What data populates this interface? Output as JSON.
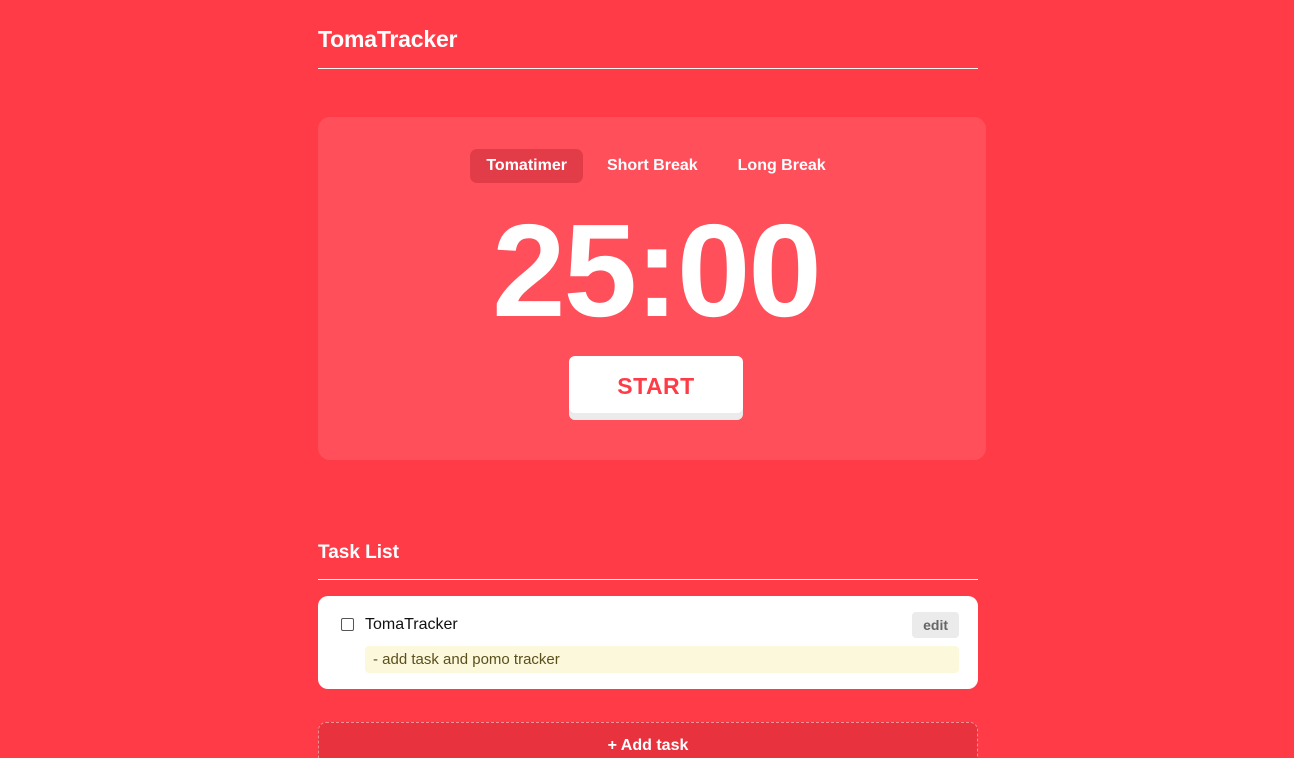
{
  "app": {
    "title": "TomaTracker"
  },
  "timer": {
    "modes": [
      {
        "label": "Tomatimer",
        "active": true
      },
      {
        "label": "Short Break",
        "active": false
      },
      {
        "label": "Long Break",
        "active": false
      }
    ],
    "time": "25:00",
    "start_label": "START"
  },
  "tasks": {
    "heading": "Task List",
    "items": [
      {
        "title": "TomaTracker",
        "checked": false,
        "edit_label": "edit",
        "note": "- add task and pomo tracker"
      }
    ],
    "add_label": "+ Add task"
  },
  "colors": {
    "background": "#ff3b47",
    "card": "#ff4f5b",
    "active_tab": "#e33c49",
    "note_bg": "#fcf8dc"
  }
}
